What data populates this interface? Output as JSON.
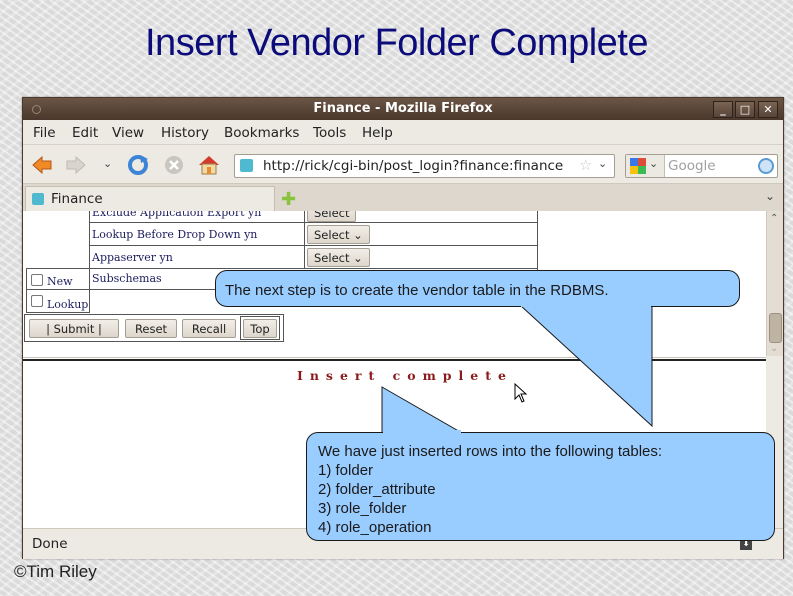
{
  "slide": {
    "title": "Insert Vendor Folder Complete",
    "copyright": "©Tim Riley"
  },
  "window": {
    "title": "Finance - Mozilla Firefox",
    "controls": {
      "minimize": "_",
      "maximize": "□",
      "close": "✕"
    }
  },
  "menubar": {
    "items": [
      "File",
      "Edit",
      "View",
      "History",
      "Bookmarks",
      "Tools",
      "Help"
    ]
  },
  "navbar": {
    "url": "http://rick/cgi-bin/post_login?finance:finance",
    "search_placeholder": "Google",
    "icons": [
      "back-icon",
      "forward-icon",
      "history-dropdown-icon",
      "reload-icon",
      "stop-icon",
      "home-icon"
    ]
  },
  "tabs": [
    {
      "label": "Finance",
      "active": true
    }
  ],
  "form": {
    "rows": [
      {
        "label": "Exclude Application Export yn",
        "select": "Select"
      },
      {
        "label": "Lookup Before Drop Down yn",
        "select": "Select"
      },
      {
        "label": "Appaserver yn",
        "select": "Select"
      }
    ],
    "subschemas_label": "Subschemas",
    "checkboxes": [
      {
        "label": "New",
        "checked": false
      },
      {
        "label": "Lookup",
        "checked": false
      }
    ],
    "buttons": {
      "submit": "|   Submit   |",
      "reset": "Reset",
      "recall": "Recall",
      "top": "Top"
    }
  },
  "result": {
    "message": "Insert complete"
  },
  "statusbar": {
    "status": "Done"
  },
  "callouts": {
    "next_step": "The next step is to create the vendor table in the RDBMS.",
    "inserted": "We have just inserted rows into the following tables:\n1) folder\n2) folder_attribute\n3) role_folder\n4) role_operation",
    "fill_color": "#99ccff"
  },
  "colors": {
    "title_text": "#0b0b7a",
    "titlebar": "#57443a",
    "insert_message": "#8b1a1a",
    "form_text": "#1d1d5e"
  }
}
